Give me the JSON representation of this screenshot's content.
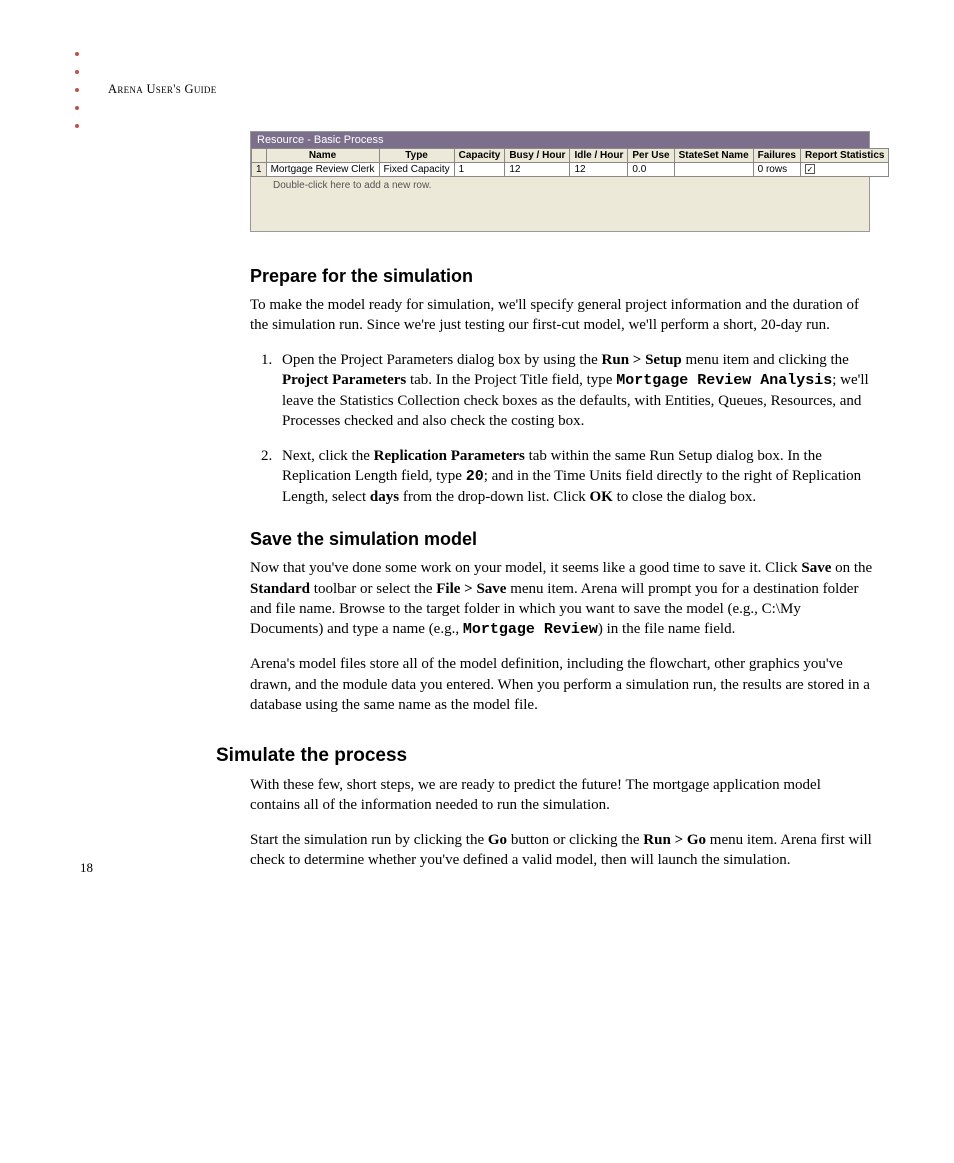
{
  "header": {
    "running_head_pre": "A",
    "running_head_mid": "rena",
    "running_head_sep": " U",
    "running_head_mid2": "ser's",
    "running_head_sep2": " G",
    "running_head_end": "uide"
  },
  "screenshot": {
    "title": "Resource - Basic Process",
    "columns": [
      "",
      "Name",
      "Type",
      "Capacity",
      "Busy / Hour",
      "Idle / Hour",
      "Per Use",
      "StateSet Name",
      "Failures",
      "Report Statistics"
    ],
    "row": {
      "num": "1",
      "name": "Mortgage Review Clerk",
      "type": "Fixed Capacity",
      "capacity": "1",
      "busy": "12",
      "idle": "12",
      "peruse": "0.0",
      "stateset": "",
      "failures": "0 rows",
      "report_checked": true
    },
    "hint": "Double-click here to add a new row."
  },
  "sections": {
    "prepare": {
      "title": "Prepare for the simulation",
      "intro": "To make the model ready for simulation, we'll specify general project information and the duration of the simulation run. Since we're just testing our first-cut model, we'll perform a short, 20-day run.",
      "step1": {
        "pre": "Open the Project Parameters dialog box by using the ",
        "b1": "Run > Setup",
        "mid1": " menu item and clicking the ",
        "b2": "Project Parameters",
        "mid2": " tab. In the Project Title field, type ",
        "mono1": "Mortgage Review Analysis",
        "post": "; we'll leave the Statistics Collection check boxes as the defaults, with Entities, Queues, Resources, and Processes checked and also check the costing box."
      },
      "step2": {
        "pre": "Next, click the ",
        "b1": "Replication Parameters",
        "mid1": " tab within the same Run Setup dialog box. In the Replication Length field, type ",
        "mono1": "20",
        "mid2": "; and in the Time Units field directly to the right of Replication Length, select ",
        "b2": "days",
        "mid3": " from the drop-down list. Click ",
        "b3": "OK",
        "post": " to close the dialog box."
      }
    },
    "save": {
      "title": "Save the simulation model",
      "p1": {
        "pre": "Now that you've done some work on your model, it seems like a good time to save it. Click ",
        "b1": "Save",
        "mid1": " on the ",
        "b2": "Standard",
        "mid2": " toolbar or select the ",
        "b3": "File > Save",
        "mid3": " menu item. Arena will prompt you for a destination folder and file name. Browse to the target folder in which you want to save the model (e.g., C:\\My Documents) and type a name (e.g., ",
        "mono1": "Mortgage Review",
        "post": ") in the file name field."
      },
      "p2": "Arena's model files store all of the model definition, including the flowchart, other graphics you've drawn, and the module data you entered. When you perform a simulation run, the results are stored in a database using the same name as the model file."
    },
    "simulate": {
      "title": "Simulate the process",
      "p1": "With these few, short steps, we are ready to predict the future! The mortgage application model contains all of the information needed to run the simulation.",
      "p2": {
        "pre": "Start the simulation run by clicking the ",
        "b1": "Go",
        "mid1": " button or clicking the ",
        "b2": "Run > Go",
        "post": " menu item. Arena first will check to determine whether you've defined a valid model, then will launch the simulation."
      }
    }
  },
  "page_number": "18"
}
